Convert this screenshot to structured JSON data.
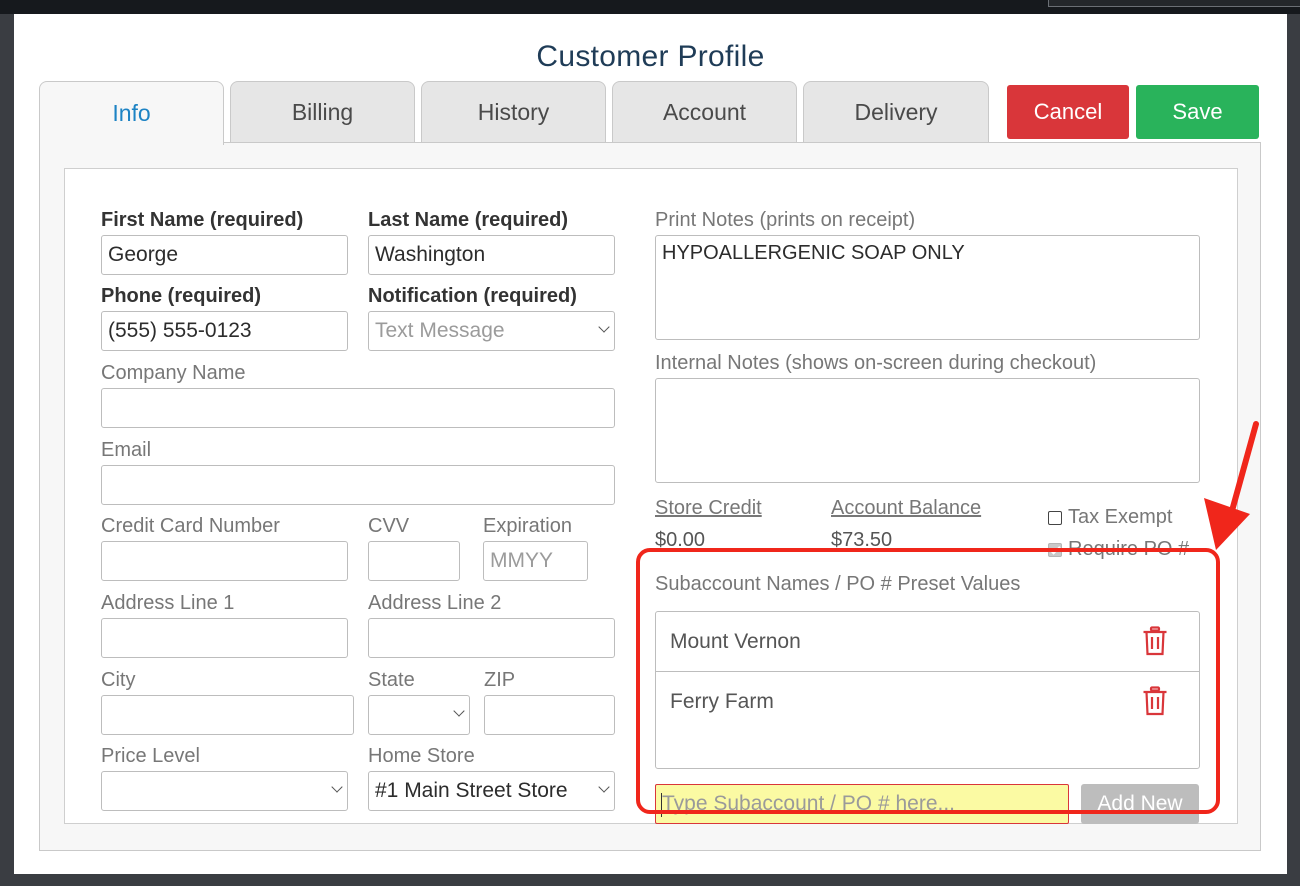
{
  "title": "Customer Profile",
  "tabs": [
    {
      "label": "Info",
      "active": true
    },
    {
      "label": "Billing"
    },
    {
      "label": "History"
    },
    {
      "label": "Account"
    },
    {
      "label": "Delivery"
    }
  ],
  "actions": {
    "cancel": "Cancel",
    "save": "Save"
  },
  "form": {
    "first_name": {
      "label": "First Name (required)",
      "value": "George"
    },
    "last_name": {
      "label": "Last Name (required)",
      "value": "Washington"
    },
    "phone": {
      "label": "Phone (required)",
      "value": "(555) 555-0123"
    },
    "notification": {
      "label": "Notification (required)",
      "value": "Text Message"
    },
    "company": {
      "label": "Company Name",
      "value": ""
    },
    "email": {
      "label": "Email",
      "value": ""
    },
    "card": {
      "label": "Credit Card Number",
      "value": ""
    },
    "cvv": {
      "label": "CVV",
      "value": ""
    },
    "expiration": {
      "label": "Expiration",
      "placeholder": "MMYY"
    },
    "address1": {
      "label": "Address Line 1",
      "value": ""
    },
    "address2": {
      "label": "Address Line 2",
      "value": ""
    },
    "city": {
      "label": "City",
      "value": ""
    },
    "state": {
      "label": "State",
      "value": ""
    },
    "zip": {
      "label": "ZIP",
      "value": ""
    },
    "price_level": {
      "label": "Price Level",
      "value": ""
    },
    "home_store": {
      "label": "Home Store",
      "value": "#1 Main Street Store"
    }
  },
  "notes": {
    "print_label": "Print Notes (prints on receipt)",
    "print_value": "HYPOALLERGENIC SOAP ONLY",
    "internal_label": "Internal Notes (shows on-screen during checkout)",
    "internal_value": ""
  },
  "balances": {
    "store_credit_label": "Store Credit",
    "store_credit_value": "$0.00",
    "account_balance_label": "Account Balance",
    "account_balance_value": "$73.50"
  },
  "flags": {
    "tax_exempt_label": "Tax Exempt",
    "tax_exempt_checked": false,
    "require_po_label": "Require PO #",
    "require_po_checked": true
  },
  "subaccounts": {
    "label": "Subaccount Names / PO # Preset Values",
    "items": [
      "Mount Vernon",
      "Ferry Farm"
    ],
    "input_placeholder": "Type Subaccount / PO # here...",
    "add_label": "Add New"
  },
  "annotation_color": "#f0261b",
  "icons": {
    "delete": "trash-icon",
    "dropdown": "chevron-down-icon",
    "pointer": "arrow-icon"
  }
}
